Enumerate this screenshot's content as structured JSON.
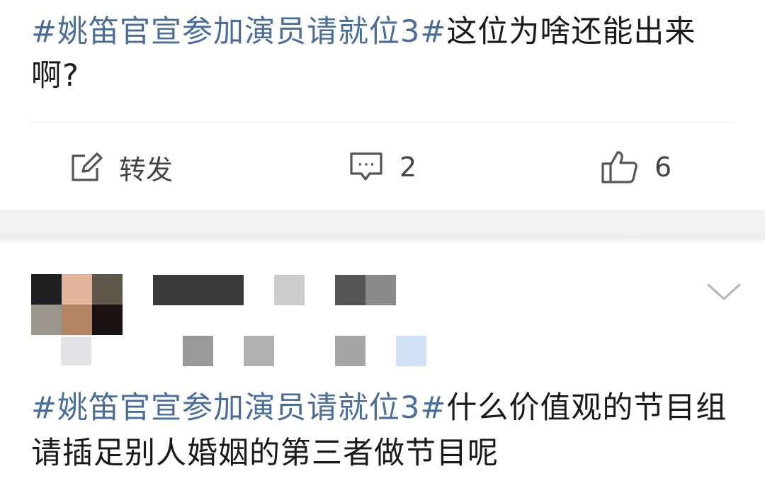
{
  "post1": {
    "hashtag": "#姚笛官宣参加演员请就位3#",
    "text": "这位为啥还能出来啊?",
    "actions": {
      "repost_label": "转发",
      "comment_count": "2",
      "like_count": "6"
    }
  },
  "post2": {
    "hashtag": "#姚笛官宣参加演员请就位3#",
    "text": "什么价值观的节目组请插足别人婚姻的第三者做节目呢"
  },
  "icons": {
    "repost": "edit-repost-icon",
    "comment": "comment-bubble-icon",
    "like": "thumbs-up-icon",
    "more": "chevron-down-icon"
  },
  "colors": {
    "hashtag": "#4a6e9c",
    "text": "#1a1a1a",
    "action": "#444444",
    "separator": "#f1f1f1"
  }
}
